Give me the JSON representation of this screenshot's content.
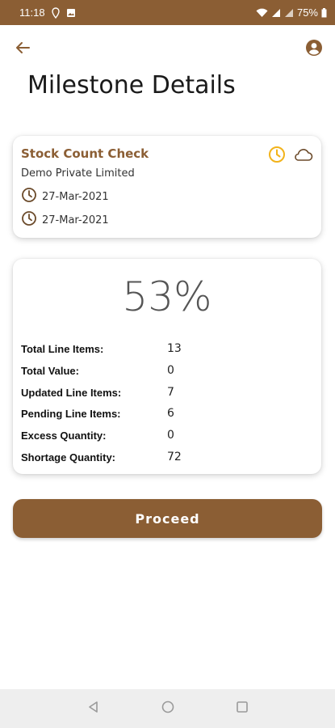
{
  "status_bar": {
    "time": "11:18",
    "battery": "75%",
    "icons": [
      "location-icon",
      "image-icon",
      "wifi-icon",
      "signal-icon",
      "signal-icon",
      "battery-icon"
    ]
  },
  "app_bar": {
    "back_icon": "arrow-left-icon",
    "profile_icon": "account-circle-icon"
  },
  "page": {
    "title": "Milestone Details"
  },
  "milestone": {
    "title": "Stock Count Check",
    "company": "Demo Private Limited",
    "start_date": "27-Mar-2021",
    "end_date": "27-Mar-2021",
    "status_icons": [
      "clock-icon",
      "cloud-icon"
    ]
  },
  "stats": {
    "percent": "53%",
    "rows": [
      {
        "label": "Total Line Items:",
        "value": "13"
      },
      {
        "label": "Total Value:",
        "value": "0"
      },
      {
        "label": "Updated Line Items:",
        "value": "7"
      },
      {
        "label": "Pending Line Items:",
        "value": "6"
      },
      {
        "label": "Excess Quantity:",
        "value": "0"
      },
      {
        "label": "Shortage Quantity:",
        "value": "72"
      }
    ]
  },
  "actions": {
    "proceed_label": "Proceed"
  },
  "colors": {
    "brand": "#8b5e34",
    "accent_clock": "#f2b31b",
    "background": "#ffffff",
    "navbar": "#eeeeee"
  }
}
